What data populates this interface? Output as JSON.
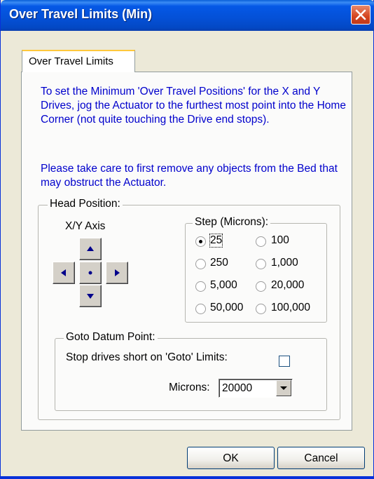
{
  "window": {
    "title": "Over Travel Limits (Min)"
  },
  "tabs": [
    {
      "label": "Over Travel Limits"
    }
  ],
  "instructions": {
    "para1": "To set the Minimum 'Over Travel Positions' for the X and Y Drives, jog the Actuator to the furthest most point into the Home Corner (not quite touching the Drive end stops).",
    "para2": "Please take care to first remove any objects from the Bed that may obstruct the Actuator."
  },
  "head_position": {
    "label": "Head Position:",
    "axis_label": "X/Y Axis"
  },
  "step": {
    "label": "Step (Microns):",
    "options": [
      "25",
      "100",
      "250",
      "1,000",
      "5,000",
      "20,000",
      "50,000",
      "100,000"
    ],
    "selected": "25"
  },
  "goto": {
    "label": "Goto Datum Point:",
    "stop_label": "Stop drives short on 'Goto' Limits:",
    "stop_checked": false,
    "microns_label": "Microns:",
    "microns_value": "20000"
  },
  "buttons": {
    "ok": "OK",
    "cancel": "Cancel"
  },
  "colors": {
    "instruction_text": "#0000cc",
    "titlebar": "#0558e6",
    "close": "#d5451f"
  }
}
